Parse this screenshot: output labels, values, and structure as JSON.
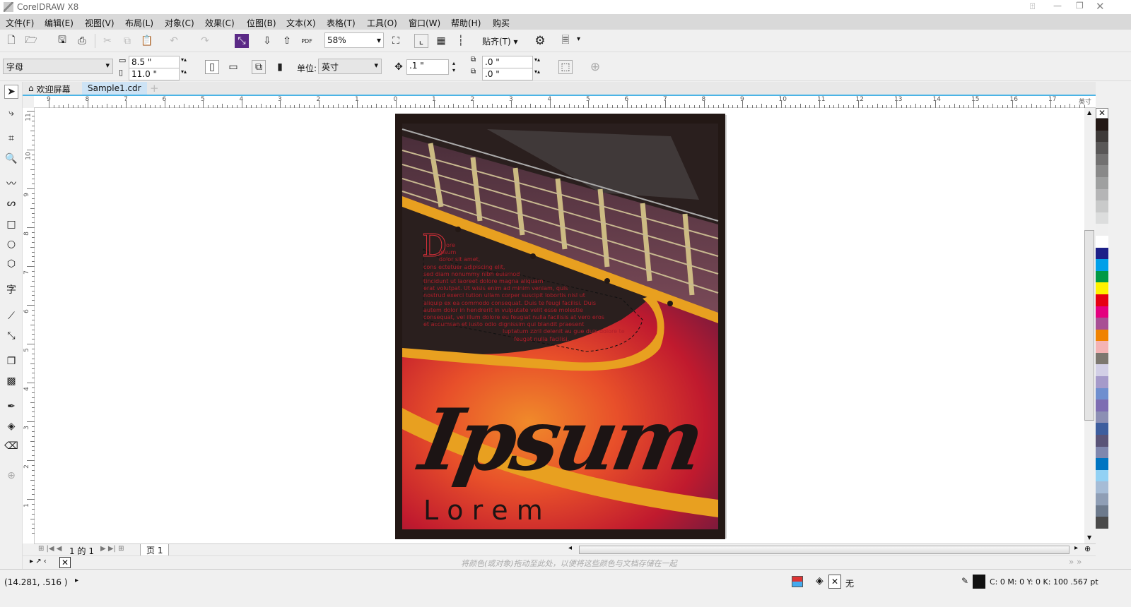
{
  "app": {
    "title": "CorelDRAW X8"
  },
  "menu": [
    "文件(F)",
    "编辑(E)",
    "视图(V)",
    "布局(L)",
    "对象(C)",
    "效果(C)",
    "位图(B)",
    "文本(X)",
    "表格(T)",
    "工具(O)",
    "窗口(W)",
    "帮助(H)",
    "购买"
  ],
  "toolbar": {
    "zoom": "58%",
    "snap_label": "贴齐(T)",
    "pdf_label": "PDF"
  },
  "property_bar": {
    "preset": "字母",
    "width": "8.5 \"",
    "height": "11.0 \"",
    "unit_label": "单位:",
    "unit": "英寸",
    "nudge": ".1 \"",
    "dup_x": ".0 \"",
    "dup_y": ".0 \""
  },
  "tabs": [
    {
      "label": "欢迎屏幕",
      "icon": "home-icon"
    },
    {
      "label": "Sample1.cdr",
      "active": true
    }
  ],
  "ruler": {
    "h_labels": [
      "9",
      "8",
      "7",
      "6",
      "5",
      "4",
      "3",
      "2",
      "1",
      "0",
      "1",
      "2",
      "3",
      "4",
      "5",
      "6",
      "7",
      "8",
      "9",
      "10",
      "11",
      "12",
      "13",
      "14",
      "15",
      "16",
      "17"
    ],
    "unit": "英寸",
    "v_labels": [
      "11",
      "10",
      "9",
      "8",
      "7",
      "6",
      "5",
      "4",
      "3",
      "2",
      "1"
    ]
  },
  "document": {
    "title_script": "Ipsum",
    "subtitle": "L o r e m",
    "drop_cap": "D",
    "body_lines": [
      "ore",
      "ipsum",
      "dolor sit amet,",
      "cons ectetuer adipiscing elit,",
      "sed diam nonummy nibh euismod",
      "tincidunt ut laoreet dolore magna aliquam",
      "erat volutpat. Ut wisis enim ad minim veniam, quis",
      "nostrud exerci tution ullam corper suscipit lobortis nisl ut",
      "aliquip ex ea commodo consequat. Duis te feugi facilisi. Duis",
      "autem dolor in hendrerit in vulputate velit esse molestie",
      "consequat, vel illum dolore eu feugiat nulla facilisis at vero eros",
      "et accumsan et iusto odio dignissim qui blandit praesent",
      "luptatum zzril delenit au gue duis dolore te",
      "feugat nulla facilisi."
    ]
  },
  "page_nav": {
    "current": "1",
    "of": "的",
    "total": "1",
    "page_tab": "页 1"
  },
  "doc_palette_hint": "将颜色(或对象)拖动至此处，以便将这些颜色与文档存储在一起",
  "palette_colors": [
    "#231815",
    "#3e3a39",
    "#595757",
    "#727171",
    "#898989",
    "#9fa0a0",
    "#b5b5b6",
    "#c9caca",
    "#dcdddd",
    "#efefef",
    "#ffffff",
    "#1d2088",
    "#00a0e9",
    "#009944",
    "#fff100",
    "#e60012",
    "#e4007f",
    "#a84f94",
    "#f08300",
    "#f4b3b4",
    "#7d7870",
    "#d2cfe6",
    "#a59aca",
    "#6f8fcf",
    "#7e6db2",
    "#8c8fb4",
    "#3e5e9e",
    "#5a5478",
    "#7f87ae",
    "#0075c2",
    "#92d1f4",
    "#a6bcd6",
    "#8f9eb5",
    "#6d7a8c",
    "#4a4a4a"
  ],
  "status": {
    "coords": "(14.281, .516 )",
    "fill_label": "无",
    "color_info": "C: 0 M: 0 Y: 0 K: 100  .567 pt"
  }
}
